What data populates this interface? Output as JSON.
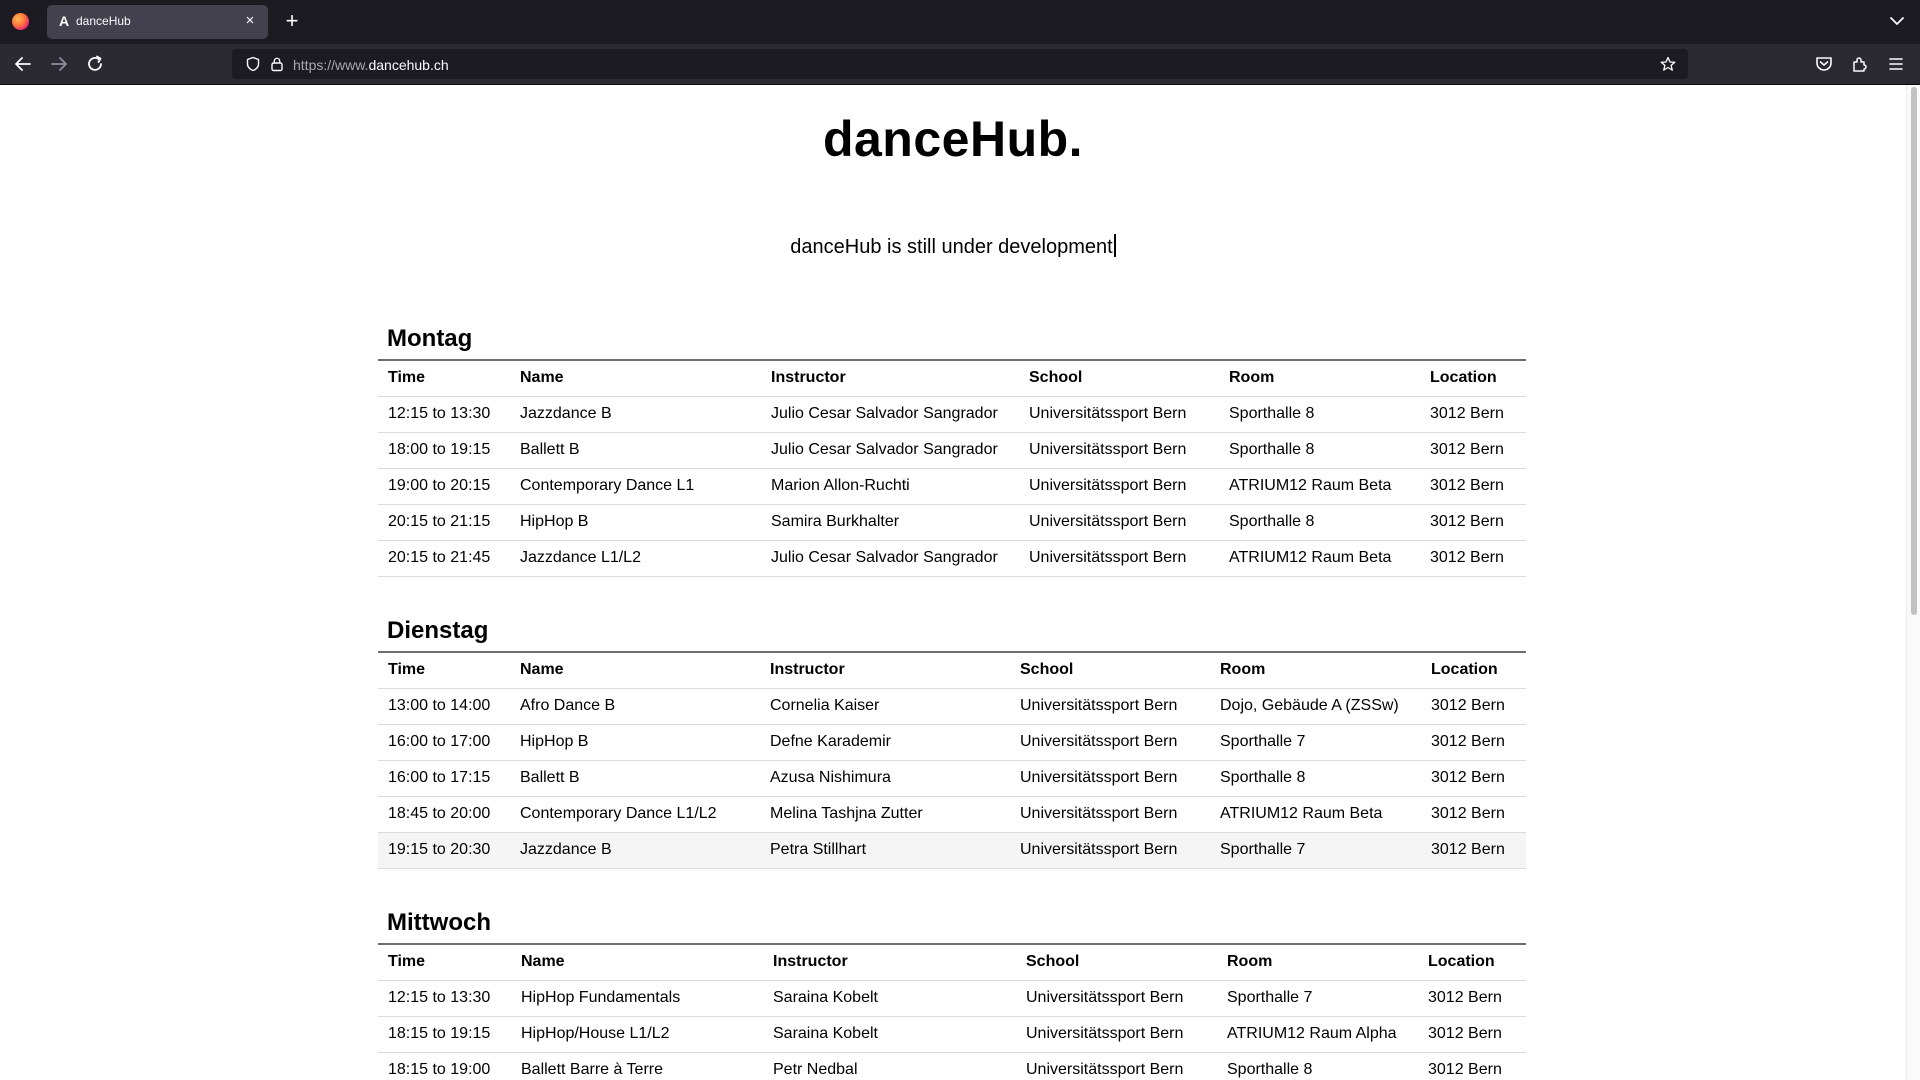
{
  "browser": {
    "tab_title": "danceHub",
    "tab_favicon": "A",
    "close_glyph": "×",
    "new_tab_glyph": "+",
    "url_scheme": "https://www.",
    "url_host": "dancehub.ch"
  },
  "site": {
    "title": "danceHub.",
    "notice": "danceHub is still under development"
  },
  "days": [
    {
      "name": "Montag",
      "headers": [
        "Time",
        "Name",
        "Instructor",
        "School",
        "Room",
        "Location"
      ],
      "rows": [
        [
          "12:15 to 13:30",
          "Jazzdance B",
          "Julio Cesar Salvador Sangrador",
          "Universitätssport Bern",
          "Sporthalle 8",
          "3012 Bern"
        ],
        [
          "18:00 to 19:15",
          "Ballett B",
          "Julio Cesar Salvador Sangrador",
          "Universitätssport Bern",
          "Sporthalle 8",
          "3012 Bern"
        ],
        [
          "19:00 to 20:15",
          "Contemporary Dance L1",
          "Marion Allon-Ruchti",
          "Universitätssport Bern",
          "ATRIUM12 Raum Beta",
          "3012 Bern"
        ],
        [
          "20:15 to 21:15",
          "HipHop B",
          "Samira Burkhalter",
          "Universitätssport Bern",
          "Sporthalle 8",
          "3012 Bern"
        ],
        [
          "20:15 to 21:45",
          "Jazzdance L1/L2",
          "Julio Cesar Salvador Sangrador",
          "Universitätssport Bern",
          "ATRIUM12 Raum Beta",
          "3012 Bern"
        ]
      ]
    },
    {
      "name": "Dienstag",
      "headers": [
        "Time",
        "Name",
        "Instructor",
        "School",
        "Room",
        "Location"
      ],
      "rows": [
        [
          "13:00 to 14:00",
          "Afro Dance B",
          "Cornelia Kaiser",
          "Universitätssport Bern",
          "Dojo, Gebäude A (ZSSw)",
          "3012 Bern"
        ],
        [
          "16:00 to 17:00",
          "HipHop B",
          "Defne Karademir",
          "Universitätssport Bern",
          "Sporthalle 7",
          "3012 Bern"
        ],
        [
          "16:00 to 17:15",
          "Ballett B",
          "Azusa Nishimura",
          "Universitätssport Bern",
          "Sporthalle 8",
          "3012 Bern"
        ],
        [
          "18:45 to 20:00",
          "Contemporary Dance L1/L2",
          "Melina Tashjna Zutter",
          "Universitätssport Bern",
          "ATRIUM12 Raum Beta",
          "3012 Bern"
        ],
        [
          "19:15 to 20:30",
          "Jazzdance B",
          "Petra Stillhart",
          "Universitätssport Bern",
          "Sporthalle 7",
          "3012 Bern"
        ]
      ]
    },
    {
      "name": "Mittwoch",
      "headers": [
        "Time",
        "Name",
        "Instructor",
        "School",
        "Room",
        "Location"
      ],
      "rows": [
        [
          "12:15 to 13:30",
          "HipHop Fundamentals",
          "Saraina Kobelt",
          "Universitätssport Bern",
          "Sporthalle 7",
          "3012 Bern"
        ],
        [
          "18:15 to 19:15",
          "HipHop/House L1/L2",
          "Saraina Kobelt",
          "Universitätssport Bern",
          "ATRIUM12 Raum Alpha",
          "3012 Bern"
        ],
        [
          "18:15 to 19:00",
          "Ballett Barre à Terre",
          "Petr Nedbal",
          "Universitätssport Bern",
          "Sporthalle 8",
          "3012 Bern"
        ]
      ]
    }
  ]
}
